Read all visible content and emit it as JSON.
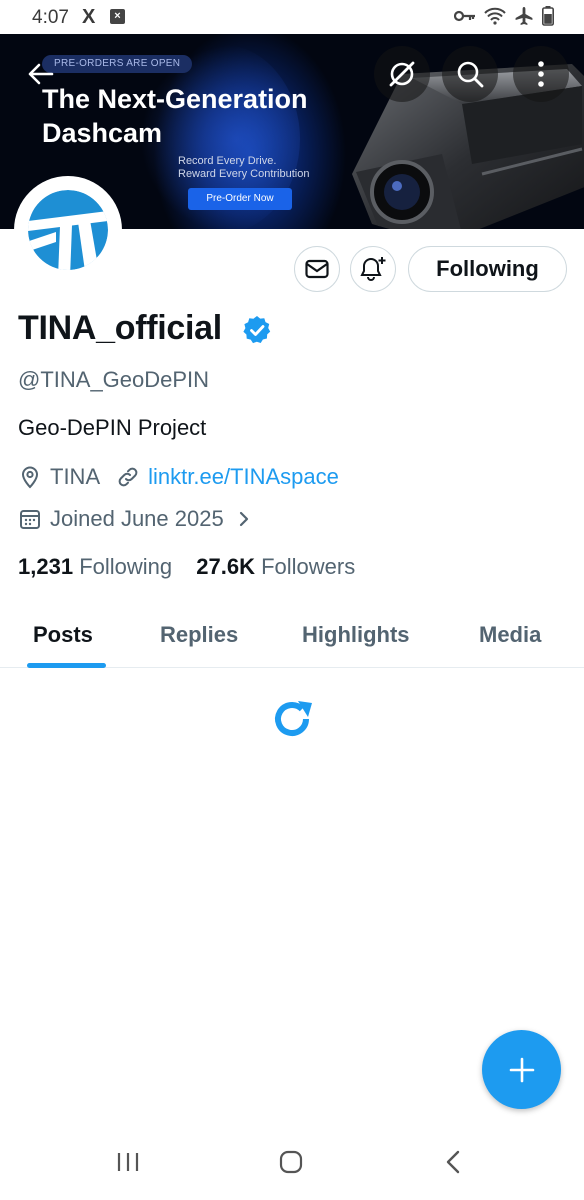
{
  "status": {
    "time": "4:07",
    "app_icon": "X",
    "notif_icon": "×",
    "icons": [
      "key-icon",
      "wifi-icon",
      "airplane-icon",
      "battery-icon"
    ]
  },
  "banner": {
    "pill": "PRE-ORDERS ARE OPEN",
    "title": "The Next-Generation Dashcam",
    "subtitle_line1": "Record Every Drive.",
    "subtitle_line2": "Reward Every Contribution",
    "cta": "Pre-Order Now"
  },
  "profile": {
    "display_name": "TINA_official",
    "handle": "@TINA_GeoDePIN",
    "bio": "Geo-DePIN Project",
    "location": "TINA",
    "link": "linktr.ee/TINAspace",
    "joined": "Joined June 2025",
    "following_count": "1,231",
    "following_label": "Following",
    "followers_count": "27.6K",
    "followers_label": "Followers",
    "follow_button": "Following"
  },
  "tabs": [
    {
      "label": "Posts",
      "active": true
    },
    {
      "label": "Replies",
      "active": false
    },
    {
      "label": "Highlights",
      "active": false
    },
    {
      "label": "Media",
      "active": false
    }
  ],
  "colors": {
    "accent": "#1d9bf0",
    "text": "#0f1419",
    "secondary": "#536471"
  }
}
